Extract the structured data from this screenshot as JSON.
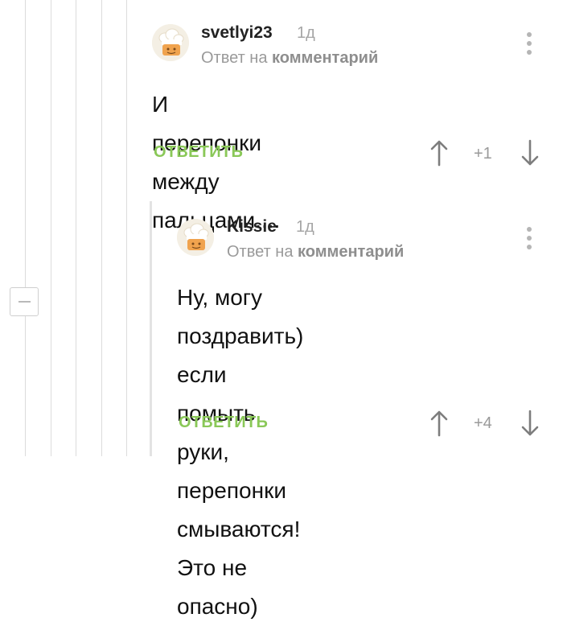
{
  "comments": [
    {
      "author": "svetlyi23",
      "time": "1д",
      "reply_prefix": "Ответ на",
      "reply_target": "комментарий",
      "text": "И перепонки между пальцами....",
      "reply_label": "ОТВЕТИТЬ",
      "rating": "+1"
    },
    {
      "author": "Kissie",
      "time": "1д",
      "reply_prefix": "Ответ на",
      "reply_target": "комментарий",
      "text_lines": [
        "Ну, могу поздравить) если",
        "помыть руки, перепонки",
        "смываются! Это не опасно)"
      ],
      "reply_label": "ОТВЕТИТЬ",
      "rating": "+4"
    }
  ],
  "colors": {
    "accent_green": "#8ac858",
    "muted_text": "#9a9a9a",
    "thread_line": "#dcdcdc"
  },
  "icons": [
    "more-vertical-icon",
    "upvote-arrow-icon",
    "downvote-arrow-icon",
    "collapse-minus-icon",
    "chef-avatar"
  ]
}
